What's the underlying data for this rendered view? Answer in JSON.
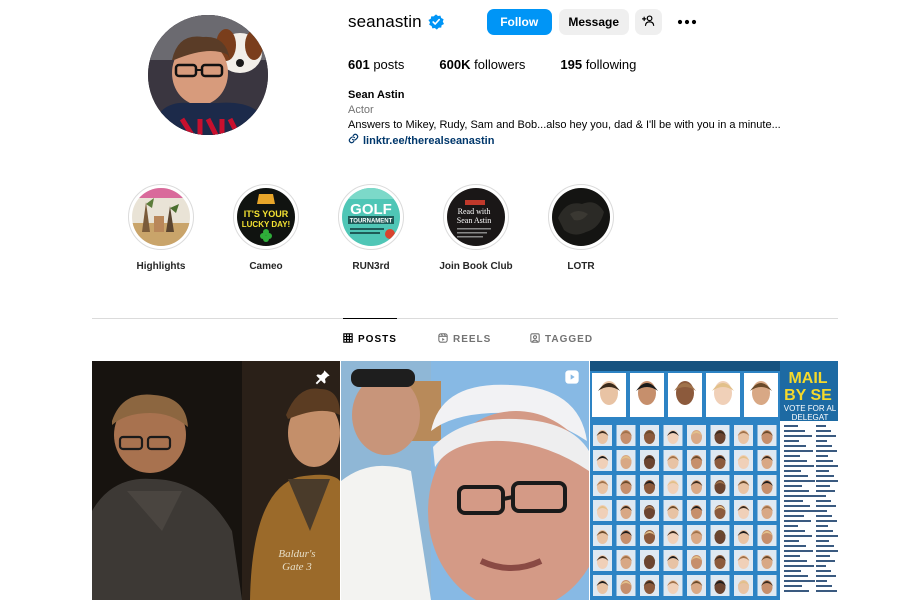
{
  "profile": {
    "username": "seanastin",
    "verified": true,
    "follow_label": "Follow",
    "message_label": "Message",
    "stats": {
      "posts_count": "601",
      "posts_label": "posts",
      "followers_count": "600K",
      "followers_label": "followers",
      "following_count": "195",
      "following_label": "following"
    },
    "bio": {
      "name": "Sean Astin",
      "category": "Actor",
      "description": "Answers to Mikey, Rudy, Sam and Bob...also hey you, dad & I'll be with you in a minute...",
      "link": "linktr.ee/therealseanastin"
    }
  },
  "highlights": [
    {
      "label": "Highlights"
    },
    {
      "label": "Cameo",
      "art_text_1": "IT'S YOUR",
      "art_text_2": "LUCKY DAY!"
    },
    {
      "label": "RUN3rd",
      "art_text_1": "GOLF",
      "art_text_2": "TOURNAMENT"
    },
    {
      "label": "Join Book Club",
      "art_text_1": "Read with",
      "art_text_2": "Sean Astin"
    },
    {
      "label": "LOTR"
    }
  ],
  "tabs": [
    {
      "label": "POSTS",
      "active": true,
      "icon": "grid-icon"
    },
    {
      "label": "REELS",
      "active": false,
      "icon": "reels-icon"
    },
    {
      "label": "TAGGED",
      "active": false,
      "icon": "tagged-icon"
    }
  ],
  "posts": [
    {
      "type": "pinned",
      "icon": "pin-icon"
    },
    {
      "type": "reel",
      "icon": "reel-icon"
    },
    {
      "type": "image",
      "headline": "MAIL",
      "headline_2": "BY SE",
      "sub": "VOTE FOR AL",
      "sub_2": "DELEGAT"
    }
  ],
  "colors": {
    "accent": "#0095f6",
    "button_gray": "#efefef",
    "link": "#00376b",
    "muted": "#737373",
    "divider": "#dbdbdb"
  }
}
